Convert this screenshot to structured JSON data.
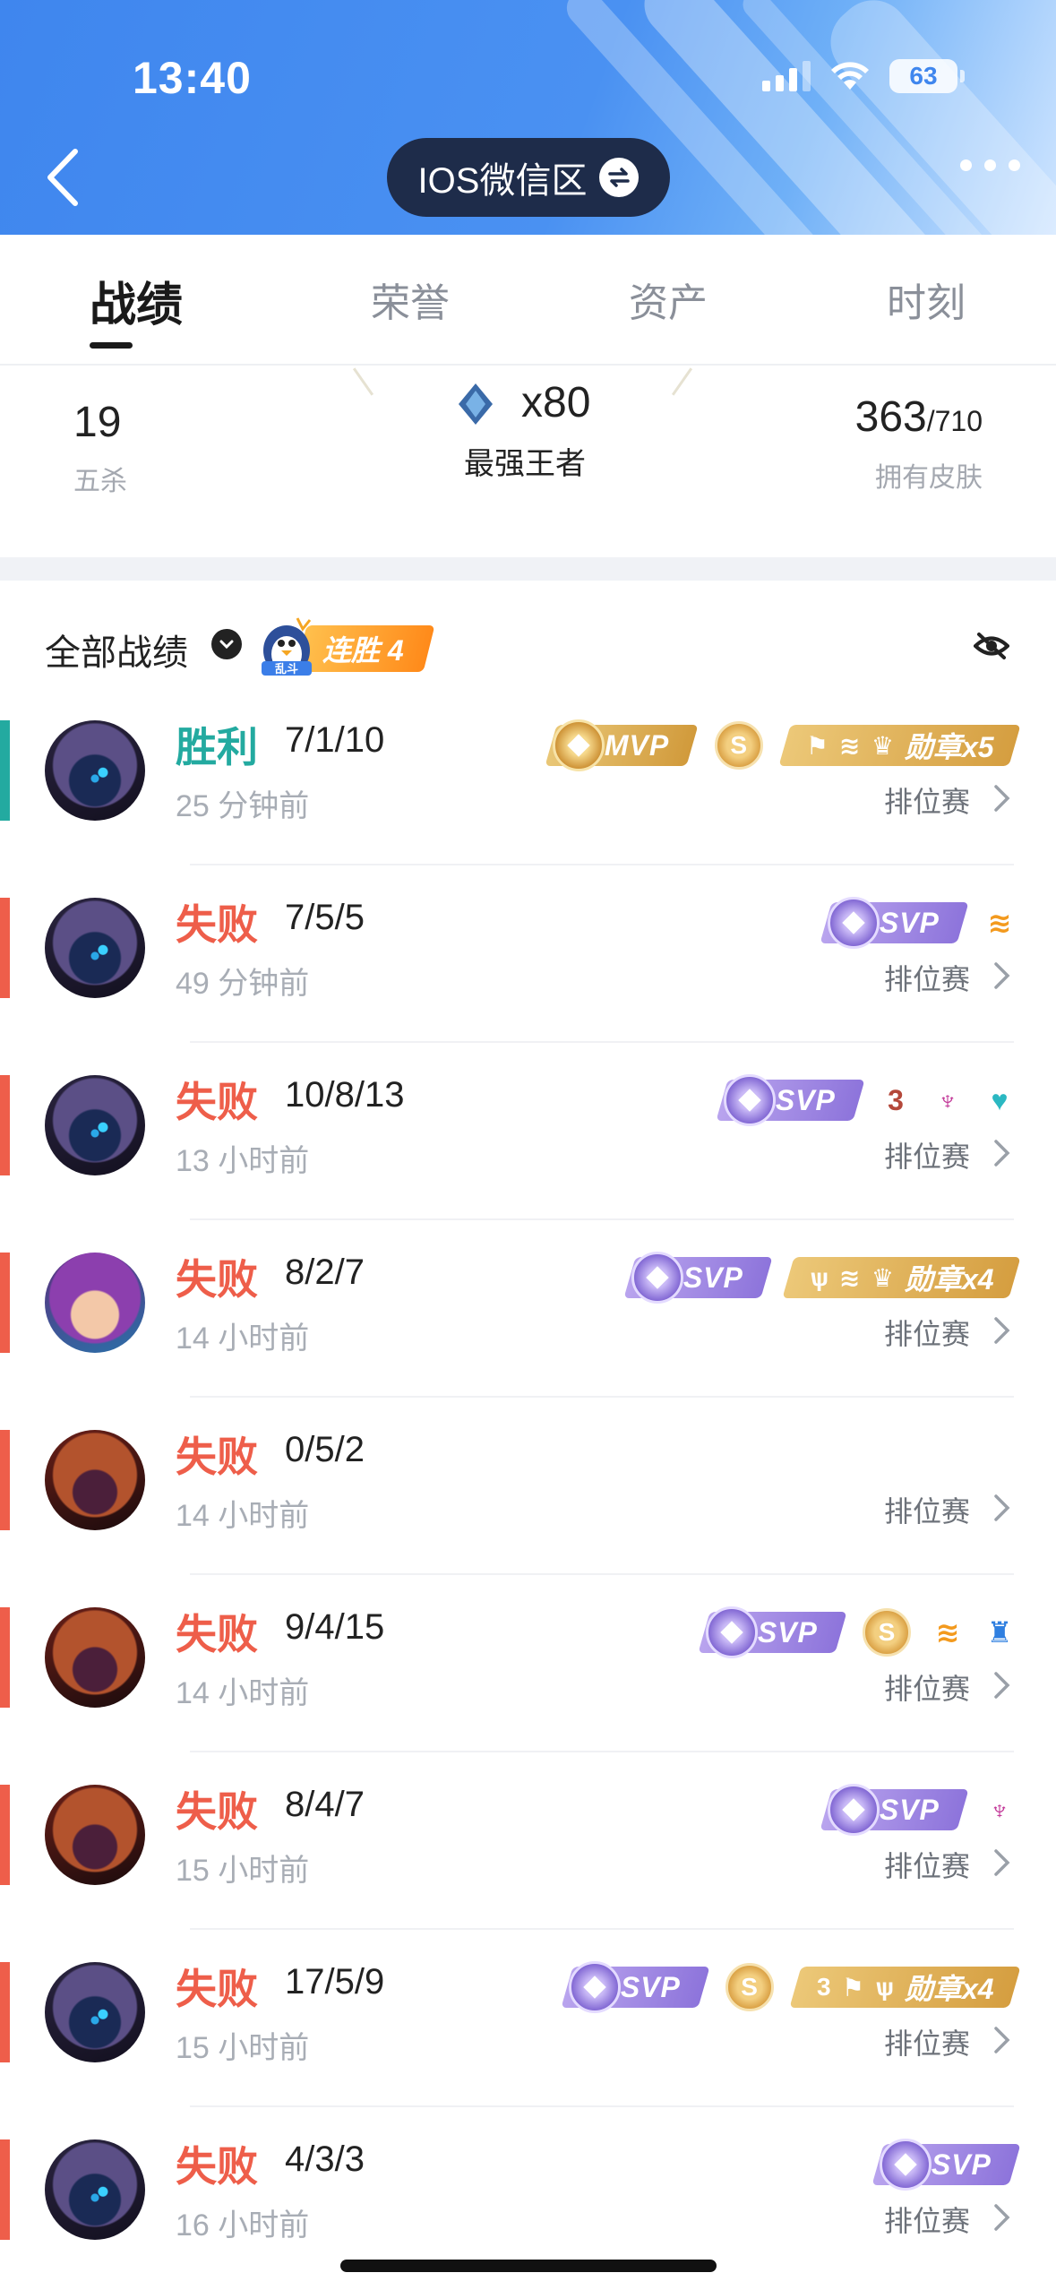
{
  "status": {
    "time": "13:40",
    "battery": "63"
  },
  "header": {
    "server": "IOS微信区"
  },
  "tabs": [
    {
      "label": "战绩",
      "active": true
    },
    {
      "label": "荣誉",
      "active": false
    },
    {
      "label": "资产",
      "active": false
    },
    {
      "label": "时刻",
      "active": false
    }
  ],
  "stats": {
    "pentakill": {
      "value": "19",
      "label": "五杀"
    },
    "king": {
      "value": "x80",
      "label": "最强王者"
    },
    "skins": {
      "owned": "363",
      "total": "/710",
      "label": "拥有皮肤"
    }
  },
  "filter": {
    "label": "全部战绩",
    "streak_mode": "乱斗",
    "streak": "连胜 4"
  },
  "matches": [
    {
      "result": "胜利",
      "outcome": "win",
      "kda": "7/1/10",
      "time": "25 分钟前",
      "mode": "排位赛",
      "hero": "hooded-blue"
    },
    {
      "result": "失败",
      "outcome": "lose",
      "kda": "7/5/5",
      "time": "49 分钟前",
      "mode": "排位赛",
      "hero": "hooded-blue"
    },
    {
      "result": "失败",
      "outcome": "lose",
      "kda": "10/8/13",
      "time": "13 小时前",
      "mode": "排位赛",
      "hero": "hooded-blue"
    },
    {
      "result": "失败",
      "outcome": "lose",
      "kda": "8/2/7",
      "time": "14 小时前",
      "mode": "排位赛",
      "hero": "purple-hair"
    },
    {
      "result": "失败",
      "outcome": "lose",
      "kda": "0/5/2",
      "time": "14 小时前",
      "mode": "排位赛",
      "hero": "red-armor"
    },
    {
      "result": "失败",
      "outcome": "lose",
      "kda": "9/4/15",
      "time": "14 小时前",
      "mode": "排位赛",
      "hero": "red-armor"
    },
    {
      "result": "失败",
      "outcome": "lose",
      "kda": "8/4/7",
      "time": "15 小时前",
      "mode": "排位赛",
      "hero": "red-armor"
    },
    {
      "result": "失败",
      "outcome": "lose",
      "kda": "17/5/9",
      "time": "15 小时前",
      "mode": "排位赛",
      "hero": "hooded-blue"
    },
    {
      "result": "失败",
      "outcome": "lose",
      "kda": "4/3/3",
      "time": "16 小时前",
      "mode": "排位赛",
      "hero": "hooded-blue"
    }
  ],
  "badges": {
    "mvp": "MVP",
    "svp": "SVP",
    "coin": "S",
    "medal5": "勋章x5",
    "medal4": "勋章x4",
    "triple": "3"
  },
  "colors": {
    "win": "#23aaa0",
    "lose": "#ee5e4a",
    "header": "#4a91f2",
    "pill": "#1e2c4a"
  }
}
